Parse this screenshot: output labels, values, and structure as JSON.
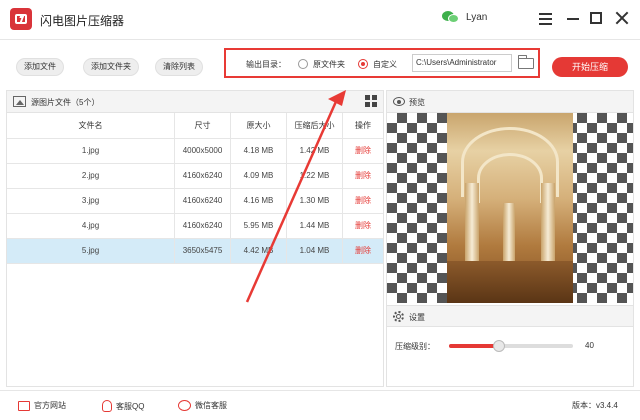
{
  "app": {
    "title": "闪电图片压缩器",
    "user": "Lyan"
  },
  "toolbar": {
    "add_file": "添加文件",
    "add_folder": "添加文件夹",
    "clear_list": "清除列表",
    "output_label": "输出目录：",
    "opt_original": "原文件夹",
    "opt_custom": "自定义",
    "selected_option": "自定义",
    "path_value": "C:\\Users\\Administrator",
    "start_label": "开始压缩"
  },
  "files": {
    "title": "源图片文件（5个）",
    "columns": [
      "文件名",
      "尺寸",
      "原大小",
      "压缩后大小",
      "操作"
    ],
    "rows": [
      {
        "name": "1.jpg",
        "dims": "4000x5000",
        "orig": "4.18 MB",
        "comp": "1.42 MB",
        "action": "删除"
      },
      {
        "name": "2.jpg",
        "dims": "4160x6240",
        "orig": "4.09 MB",
        "comp": "1.22 MB",
        "action": "删除"
      },
      {
        "name": "3.jpg",
        "dims": "4160x6240",
        "orig": "4.16 MB",
        "comp": "1.30 MB",
        "action": "删除"
      },
      {
        "name": "4.jpg",
        "dims": "4160x6240",
        "orig": "5.95 MB",
        "comp": "1.44 MB",
        "action": "删除"
      },
      {
        "name": "5.jpg",
        "dims": "3650x5475",
        "orig": "4.42 MB",
        "comp": "1.04 MB",
        "action": "删除"
      }
    ],
    "selected_row": "5.jpg"
  },
  "preview": {
    "title": "预览"
  },
  "settings": {
    "title": "设置",
    "level_label": "压缩级别：",
    "level_value": "40",
    "level_fraction": 0.4
  },
  "footer": {
    "website": "官方网站",
    "qq": "客服QQ",
    "wechat": "微信客服",
    "version": "版本：v3.4.4"
  },
  "colors": {
    "accent": "#e53935",
    "selected_row": "#d4ebf8",
    "annotation": "#e83a35"
  },
  "icons": [
    "app-logo-icon",
    "wechat-icon",
    "menu-icon",
    "minimize-icon",
    "maximize-icon",
    "close-icon",
    "folder-icon",
    "image-icon",
    "grid-view-icon",
    "eye-icon",
    "gear-icon",
    "monitor-icon",
    "qq-icon",
    "chat-icon"
  ]
}
